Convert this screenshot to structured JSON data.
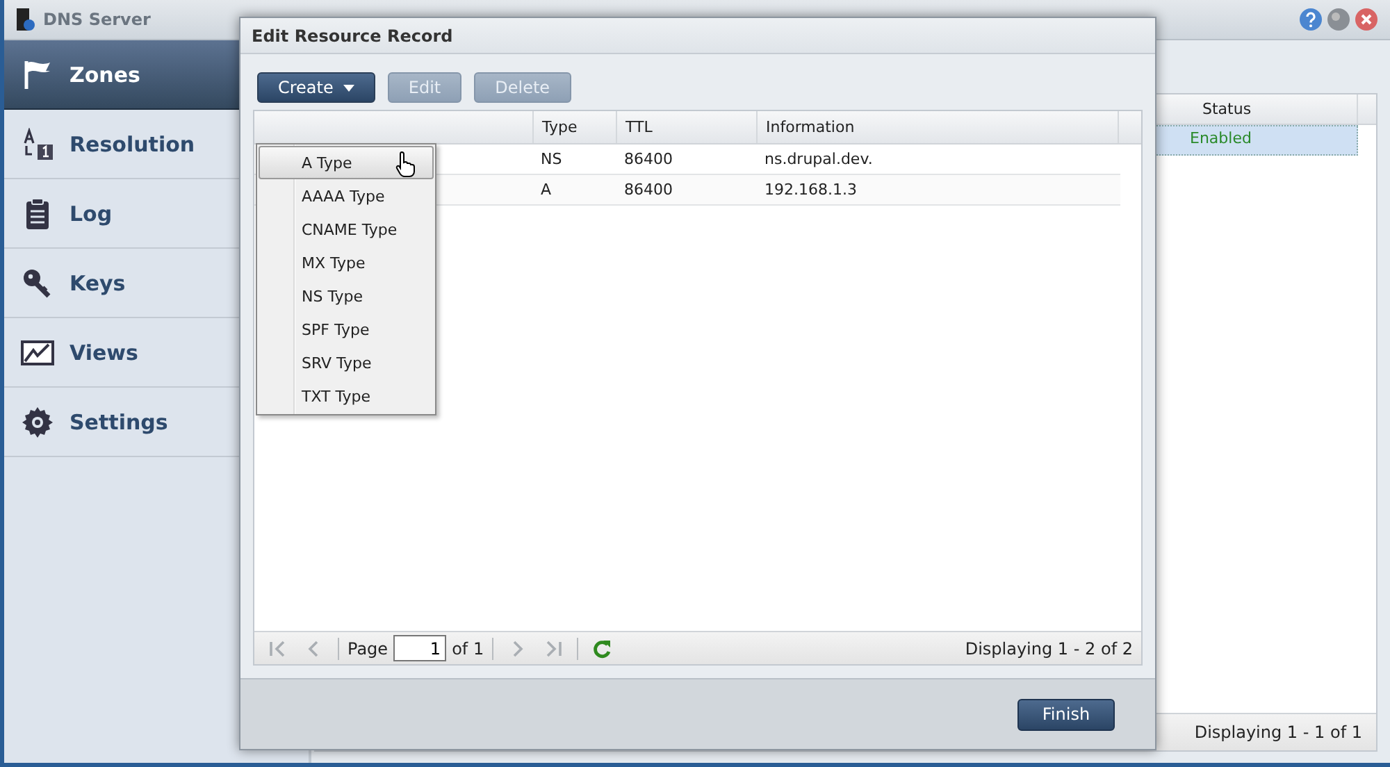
{
  "window": {
    "title": "DNS Server"
  },
  "sidebar": {
    "items": [
      {
        "label": "Zones",
        "kind": "flag",
        "selected": true
      },
      {
        "label": "Resolution",
        "kind": "resolution",
        "selected": false
      },
      {
        "label": "Log",
        "kind": "clipboard",
        "selected": false
      },
      {
        "label": "Keys",
        "kind": "key",
        "selected": false
      },
      {
        "label": "Views",
        "kind": "views",
        "selected": false
      },
      {
        "label": "Settings",
        "kind": "gear",
        "selected": false
      }
    ]
  },
  "zones_table": {
    "columns": [
      "Status"
    ],
    "rows": [
      {
        "status": "Enabled",
        "selected": true
      }
    ],
    "status_text": "Displaying 1 - 1 of 1"
  },
  "dialog": {
    "title": "Edit Resource Record",
    "toolbar": [
      {
        "label": "Create",
        "kind": "dropdown",
        "disabled": false
      },
      {
        "label": "Edit",
        "kind": "plain",
        "disabled": true
      },
      {
        "label": "Delete",
        "kind": "plain",
        "disabled": true
      }
    ],
    "create_menu": {
      "items": [
        {
          "label": "A Type",
          "highlighted": true
        },
        {
          "label": "AAAA Type",
          "highlighted": false
        },
        {
          "label": "CNAME Type",
          "highlighted": false
        },
        {
          "label": "MX Type",
          "highlighted": false
        },
        {
          "label": "NS Type",
          "highlighted": false
        },
        {
          "label": "SPF Type",
          "highlighted": false
        },
        {
          "label": "SRV Type",
          "highlighted": false
        },
        {
          "label": "TXT Type",
          "highlighted": false
        }
      ]
    },
    "table": {
      "columns": [
        "Type",
        "TTL",
        "Information"
      ],
      "rows": [
        {
          "type": "NS",
          "ttl": "86400",
          "information": "ns.drupal.dev."
        },
        {
          "type": "A",
          "ttl": "86400",
          "information": "192.168.1.3"
        }
      ]
    },
    "paging": {
      "buttons": [
        {
          "kind": "first",
          "disabled": true
        },
        {
          "kind": "prev",
          "disabled": true
        },
        {
          "kind": "next",
          "disabled": true
        },
        {
          "kind": "last",
          "disabled": true
        },
        {
          "kind": "refresh",
          "disabled": false
        }
      ],
      "page_label": "Page",
      "page": "1",
      "of_label": "of 1",
      "status_text": "Displaying 1 - 2 of 2"
    },
    "buttons": [
      {
        "label": "Finish"
      }
    ]
  }
}
